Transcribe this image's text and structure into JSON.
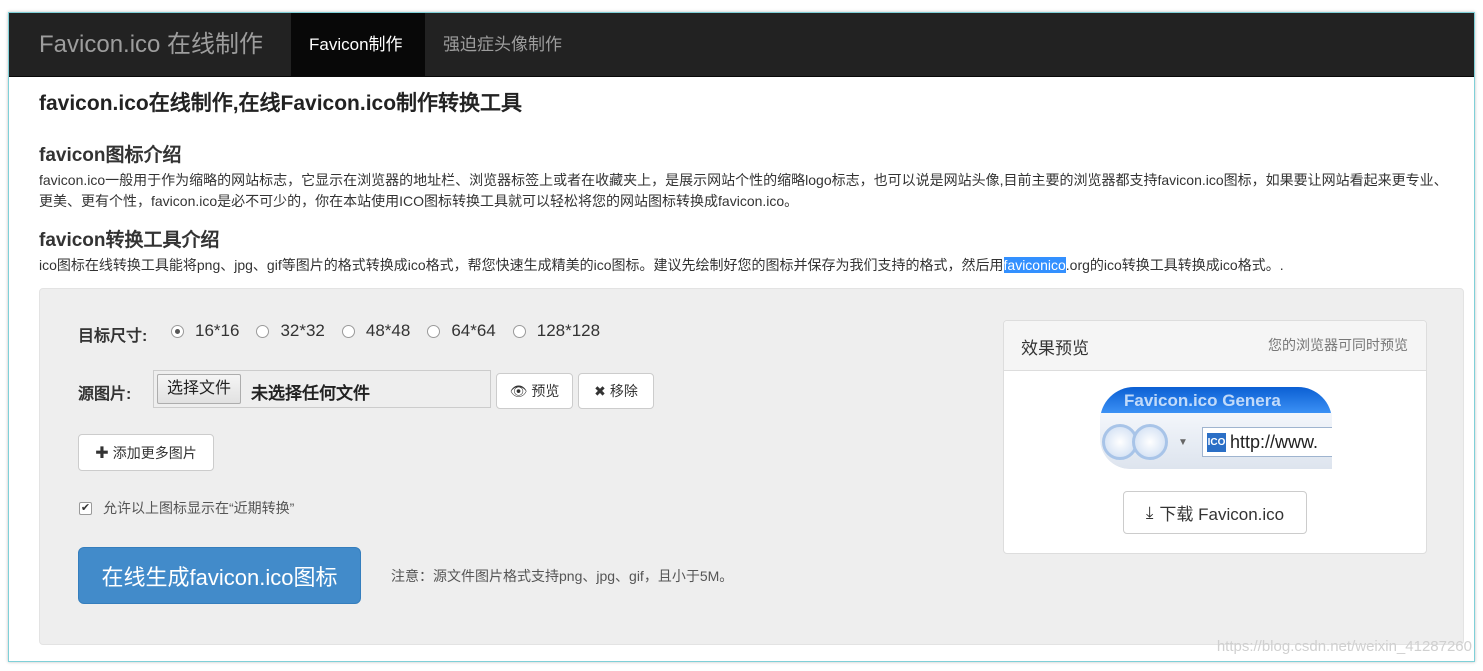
{
  "navbar": {
    "brand": "Favicon.ico 在线制作",
    "items": [
      {
        "label": "Favicon制作",
        "active": true
      },
      {
        "label": "强迫症头像制作",
        "active": false
      }
    ]
  },
  "page": {
    "title": "favicon.ico在线制作,在线Favicon.ico制作转换工具",
    "sections": [
      {
        "heading": "favicon图标介绍",
        "text": "favicon.ico一般用于作为缩略的网站标志，它显示在浏览器的地址栏、浏览器标签上或者在收藏夹上，是展示网站个性的缩略logo标志，也可以说是网站头像,目前主要的浏览器都支持favicon.ico图标，如果要让网站看起来更专业、更美、更有个性，favicon.ico是必不可少的，你在本站使用ICO图标转换工具就可以轻松将您的网站图标转换成favicon.ico。"
      },
      {
        "heading": "favicon转换工具介绍",
        "text_before": "ico图标在线转换工具能将png、jpg、gif等图片的格式转换成ico格式，帮您快速生成精美的ico图标。建议先绘制好您的图标并保存为我们支持的格式，然后用",
        "text_highlight": "faviconico",
        "text_after": ".org的ico转换工具转换成ico格式。."
      }
    ]
  },
  "form": {
    "size_label": "目标尺寸:",
    "sizes": [
      {
        "label": "16*16",
        "checked": true
      },
      {
        "label": "32*32",
        "checked": false
      },
      {
        "label": "48*48",
        "checked": false
      },
      {
        "label": "64*64",
        "checked": false
      },
      {
        "label": "128*128",
        "checked": false
      }
    ],
    "source_label": "源图片:",
    "file_button": "选择文件",
    "file_status": "未选择任何文件",
    "preview_button": "预览",
    "remove_button": "移除",
    "add_more_button": "添加更多图片",
    "allow_recent_label": "允许以上图标显示在“近期转换”",
    "allow_recent_checked": true,
    "generate_button": "在线生成favicon.ico图标",
    "note": "注意：源文件图片格式支持png、jpg、gif，且小于5M。"
  },
  "preview_panel": {
    "title": "效果预览",
    "hint": "您的浏览器可同时预览",
    "image_top_text": "Favicon.ico Genera",
    "image_icon_text": "ICO",
    "image_url_text": "http://www.",
    "download_button": "下载 Favicon.ico"
  },
  "watermark": "https://blog.csdn.net/weixin_41287260",
  "colors": {
    "navbar_bg": "#222222",
    "nav_active_bg": "#080808",
    "primary": "#428bca",
    "well_bg": "#eeeeee",
    "highlight": "#3390ff"
  },
  "icons": {
    "preview": "eye-icon",
    "remove": "close-icon",
    "add": "plus-icon",
    "download": "download-icon"
  }
}
